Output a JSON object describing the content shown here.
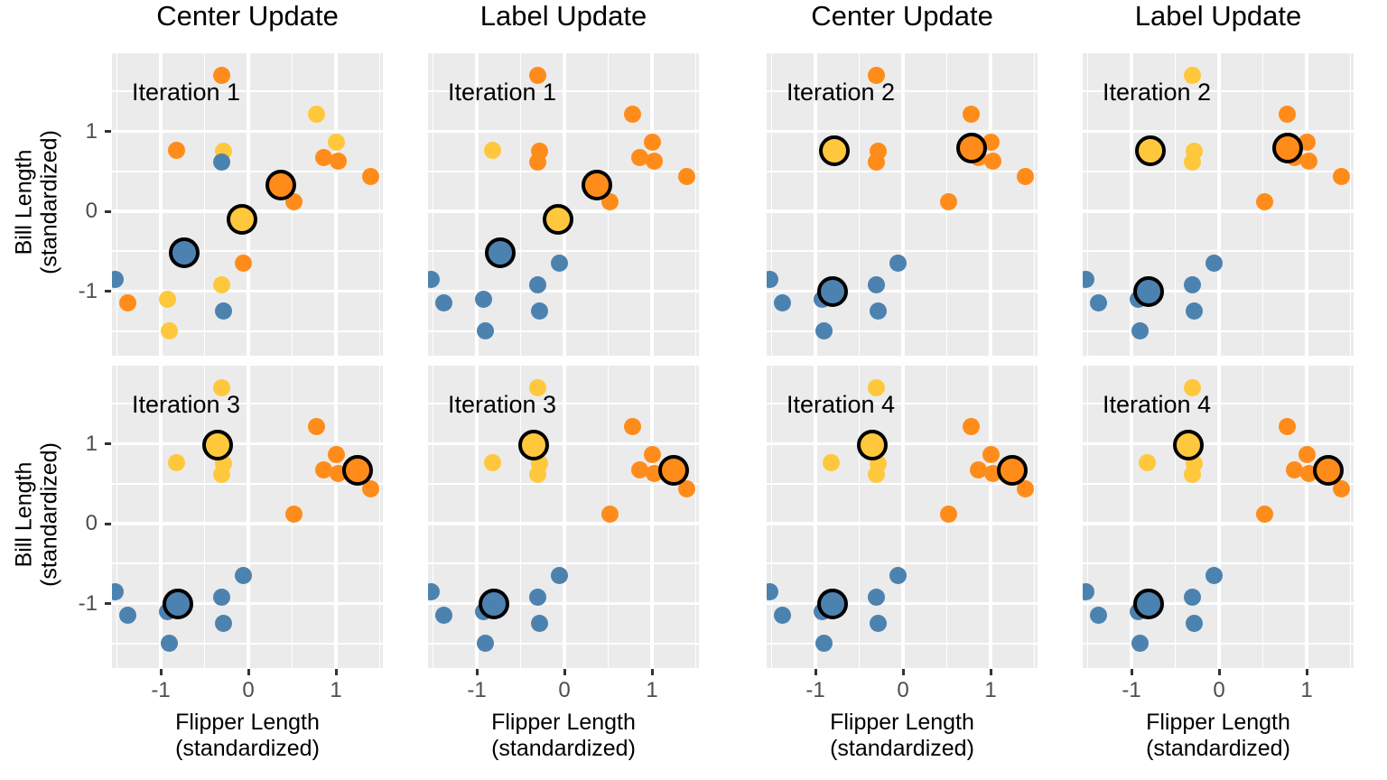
{
  "figure": {
    "type": "small-multiples-scatter",
    "panel_rows": 2,
    "panel_cols": 4,
    "background": "#ffffff",
    "panel_fill": "#ebebeb",
    "gridline_color": "#ffffff"
  },
  "column_titles": [
    "Center Update",
    "Label Update",
    "Center Update",
    "Label Update"
  ],
  "axis": {
    "y_title_line1": "Bill Length",
    "y_title_line2": "(standardized)",
    "x_title_line1": "Flipper Length",
    "x_title_line2": "(standardized)",
    "x_ticks": [
      "-1",
      "0",
      "1"
    ],
    "x_tick_values": [
      -1,
      0,
      1
    ],
    "y_ticks": [
      "1",
      "0",
      "-1"
    ],
    "y_tick_values": [
      1,
      0,
      -1
    ],
    "xlim": [
      -1.72,
      1.62
    ],
    "ylim": [
      -1.72,
      1.78
    ]
  },
  "colors": {
    "blue": "#4C82B0",
    "orange": "#FF8C1A",
    "yellow": "#FFC83C",
    "center_stroke": "#000000",
    "tick_label": "#4d4d4d",
    "tick_mark": "#333333"
  },
  "legend": {
    "cluster_names": [
      "blue",
      "orange",
      "yellow"
    ]
  },
  "chart_data": {
    "type": "scatter",
    "title": "",
    "xlabel": "Flipper Length (standardized)",
    "ylabel": "Bill Length (standardized)",
    "xlim": [
      -1.72,
      1.62
    ],
    "ylim": [
      -1.72,
      1.78
    ],
    "grid": true,
    "legend_position": "none",
    "panels": [
      {
        "row": 0,
        "col": 0,
        "column_title": "Center Update",
        "tag": "Iteration 1",
        "points": [
          {
            "x": -0.3,
            "y": 1.7,
            "c": "orange"
          },
          {
            "x": 0.78,
            "y": 1.22,
            "c": "yellow"
          },
          {
            "x": -0.82,
            "y": 0.76,
            "c": "orange"
          },
          {
            "x": -0.28,
            "y": 0.75,
            "c": "yellow"
          },
          {
            "x": -0.3,
            "y": 0.62,
            "c": "blue"
          },
          {
            "x": 1.0,
            "y": 0.86,
            "c": "yellow"
          },
          {
            "x": 0.86,
            "y": 0.67,
            "c": "orange"
          },
          {
            "x": 1.03,
            "y": 0.63,
            "c": "orange"
          },
          {
            "x": 1.4,
            "y": 0.43,
            "c": "orange"
          },
          {
            "x": 0.52,
            "y": 0.12,
            "c": "orange"
          },
          {
            "x": -0.06,
            "y": -0.65,
            "c": "orange"
          },
          {
            "x": -1.52,
            "y": -0.85,
            "c": "blue"
          },
          {
            "x": -0.3,
            "y": -0.92,
            "c": "yellow"
          },
          {
            "x": -1.38,
            "y": -1.15,
            "c": "orange"
          },
          {
            "x": -0.92,
            "y": -1.1,
            "c": "yellow"
          },
          {
            "x": -0.28,
            "y": -1.25,
            "c": "blue"
          },
          {
            "x": -0.9,
            "y": -1.5,
            "c": "yellow"
          }
        ],
        "centers": [
          {
            "x": -0.73,
            "y": -0.52,
            "c": "blue"
          },
          {
            "x": -0.07,
            "y": -0.1,
            "c": "yellow"
          },
          {
            "x": 0.37,
            "y": 0.33,
            "c": "orange"
          }
        ]
      },
      {
        "row": 0,
        "col": 1,
        "column_title": "Label Update",
        "tag": "Iteration 1",
        "points": [
          {
            "x": -0.3,
            "y": 1.7,
            "c": "orange"
          },
          {
            "x": 0.78,
            "y": 1.22,
            "c": "orange"
          },
          {
            "x": -0.82,
            "y": 0.76,
            "c": "yellow"
          },
          {
            "x": -0.28,
            "y": 0.75,
            "c": "orange"
          },
          {
            "x": -0.3,
            "y": 0.62,
            "c": "orange"
          },
          {
            "x": 1.0,
            "y": 0.86,
            "c": "orange"
          },
          {
            "x": 0.86,
            "y": 0.67,
            "c": "orange"
          },
          {
            "x": 1.03,
            "y": 0.63,
            "c": "orange"
          },
          {
            "x": 1.4,
            "y": 0.43,
            "c": "orange"
          },
          {
            "x": 0.52,
            "y": 0.12,
            "c": "orange"
          },
          {
            "x": -0.06,
            "y": -0.65,
            "c": "blue"
          },
          {
            "x": -1.52,
            "y": -0.85,
            "c": "blue"
          },
          {
            "x": -0.3,
            "y": -0.92,
            "c": "blue"
          },
          {
            "x": -1.38,
            "y": -1.15,
            "c": "blue"
          },
          {
            "x": -0.92,
            "y": -1.1,
            "c": "blue"
          },
          {
            "x": -0.28,
            "y": -1.25,
            "c": "blue"
          },
          {
            "x": -0.9,
            "y": -1.5,
            "c": "blue"
          }
        ],
        "centers": [
          {
            "x": -0.73,
            "y": -0.52,
            "c": "blue"
          },
          {
            "x": -0.07,
            "y": -0.1,
            "c": "yellow"
          },
          {
            "x": 0.37,
            "y": 0.33,
            "c": "orange"
          }
        ]
      },
      {
        "row": 0,
        "col": 2,
        "column_title": "Center Update",
        "tag": "Iteration 2",
        "points": [
          {
            "x": -0.3,
            "y": 1.7,
            "c": "orange"
          },
          {
            "x": 0.78,
            "y": 1.22,
            "c": "orange"
          },
          {
            "x": -0.82,
            "y": 0.76,
            "c": "orange"
          },
          {
            "x": -0.28,
            "y": 0.75,
            "c": "orange"
          },
          {
            "x": -0.3,
            "y": 0.62,
            "c": "orange"
          },
          {
            "x": 1.0,
            "y": 0.86,
            "c": "orange"
          },
          {
            "x": 0.86,
            "y": 0.67,
            "c": "orange"
          },
          {
            "x": 1.03,
            "y": 0.63,
            "c": "orange"
          },
          {
            "x": 1.4,
            "y": 0.43,
            "c": "orange"
          },
          {
            "x": 0.52,
            "y": 0.12,
            "c": "orange"
          },
          {
            "x": -0.06,
            "y": -0.65,
            "c": "blue"
          },
          {
            "x": -1.52,
            "y": -0.85,
            "c": "blue"
          },
          {
            "x": -0.3,
            "y": -0.92,
            "c": "blue"
          },
          {
            "x": -1.38,
            "y": -1.15,
            "c": "blue"
          },
          {
            "x": -0.92,
            "y": -1.1,
            "c": "blue"
          },
          {
            "x": -0.28,
            "y": -1.25,
            "c": "blue"
          },
          {
            "x": -0.9,
            "y": -1.5,
            "c": "blue"
          }
        ],
        "centers": [
          {
            "x": -0.8,
            "y": -1.0,
            "c": "blue"
          },
          {
            "x": -0.78,
            "y": 0.76,
            "c": "yellow"
          },
          {
            "x": 0.78,
            "y": 0.79,
            "c": "orange"
          }
        ]
      },
      {
        "row": 0,
        "col": 3,
        "column_title": "Label Update",
        "tag": "Iteration 2",
        "points": [
          {
            "x": -0.3,
            "y": 1.7,
            "c": "yellow"
          },
          {
            "x": 0.78,
            "y": 1.22,
            "c": "orange"
          },
          {
            "x": -0.82,
            "y": 0.76,
            "c": "yellow"
          },
          {
            "x": -0.28,
            "y": 0.75,
            "c": "yellow"
          },
          {
            "x": -0.3,
            "y": 0.62,
            "c": "yellow"
          },
          {
            "x": 1.0,
            "y": 0.86,
            "c": "orange"
          },
          {
            "x": 0.86,
            "y": 0.67,
            "c": "orange"
          },
          {
            "x": 1.03,
            "y": 0.63,
            "c": "orange"
          },
          {
            "x": 1.4,
            "y": 0.43,
            "c": "orange"
          },
          {
            "x": 0.52,
            "y": 0.12,
            "c": "orange"
          },
          {
            "x": -0.06,
            "y": -0.65,
            "c": "blue"
          },
          {
            "x": -1.52,
            "y": -0.85,
            "c": "blue"
          },
          {
            "x": -0.3,
            "y": -0.92,
            "c": "blue"
          },
          {
            "x": -1.38,
            "y": -1.15,
            "c": "blue"
          },
          {
            "x": -0.92,
            "y": -1.1,
            "c": "blue"
          },
          {
            "x": -0.28,
            "y": -1.25,
            "c": "blue"
          },
          {
            "x": -0.9,
            "y": -1.5,
            "c": "blue"
          }
        ],
        "centers": [
          {
            "x": -0.8,
            "y": -1.0,
            "c": "blue"
          },
          {
            "x": -0.78,
            "y": 0.76,
            "c": "yellow"
          },
          {
            "x": 0.78,
            "y": 0.79,
            "c": "orange"
          }
        ]
      },
      {
        "row": 1,
        "col": 0,
        "column_title": "Center Update",
        "tag": "Iteration 3",
        "points": [
          {
            "x": -0.3,
            "y": 1.7,
            "c": "yellow"
          },
          {
            "x": 0.78,
            "y": 1.22,
            "c": "orange"
          },
          {
            "x": -0.82,
            "y": 0.76,
            "c": "yellow"
          },
          {
            "x": -0.28,
            "y": 0.75,
            "c": "yellow"
          },
          {
            "x": -0.3,
            "y": 0.62,
            "c": "yellow"
          },
          {
            "x": 1.0,
            "y": 0.86,
            "c": "orange"
          },
          {
            "x": 0.86,
            "y": 0.67,
            "c": "orange"
          },
          {
            "x": 1.03,
            "y": 0.63,
            "c": "orange"
          },
          {
            "x": 1.4,
            "y": 0.43,
            "c": "orange"
          },
          {
            "x": 0.52,
            "y": 0.12,
            "c": "orange"
          },
          {
            "x": -0.06,
            "y": -0.65,
            "c": "blue"
          },
          {
            "x": -1.52,
            "y": -0.85,
            "c": "blue"
          },
          {
            "x": -0.3,
            "y": -0.92,
            "c": "blue"
          },
          {
            "x": -1.38,
            "y": -1.15,
            "c": "blue"
          },
          {
            "x": -0.92,
            "y": -1.1,
            "c": "blue"
          },
          {
            "x": -0.28,
            "y": -1.25,
            "c": "blue"
          },
          {
            "x": -0.9,
            "y": -1.5,
            "c": "blue"
          }
        ],
        "centers": [
          {
            "x": -0.8,
            "y": -1.0,
            "c": "blue"
          },
          {
            "x": -0.35,
            "y": 0.98,
            "c": "yellow"
          },
          {
            "x": 1.25,
            "y": 0.67,
            "c": "orange"
          }
        ]
      },
      {
        "row": 1,
        "col": 1,
        "column_title": "Label Update",
        "tag": "Iteration 3",
        "points": [
          {
            "x": -0.3,
            "y": 1.7,
            "c": "yellow"
          },
          {
            "x": 0.78,
            "y": 1.22,
            "c": "orange"
          },
          {
            "x": -0.82,
            "y": 0.76,
            "c": "yellow"
          },
          {
            "x": -0.28,
            "y": 0.75,
            "c": "yellow"
          },
          {
            "x": -0.3,
            "y": 0.62,
            "c": "yellow"
          },
          {
            "x": 1.0,
            "y": 0.86,
            "c": "orange"
          },
          {
            "x": 0.86,
            "y": 0.67,
            "c": "orange"
          },
          {
            "x": 1.03,
            "y": 0.63,
            "c": "orange"
          },
          {
            "x": 1.4,
            "y": 0.43,
            "c": "orange"
          },
          {
            "x": 0.52,
            "y": 0.12,
            "c": "orange"
          },
          {
            "x": -0.06,
            "y": -0.65,
            "c": "blue"
          },
          {
            "x": -1.52,
            "y": -0.85,
            "c": "blue"
          },
          {
            "x": -0.3,
            "y": -0.92,
            "c": "blue"
          },
          {
            "x": -1.38,
            "y": -1.15,
            "c": "blue"
          },
          {
            "x": -0.92,
            "y": -1.1,
            "c": "blue"
          },
          {
            "x": -0.28,
            "y": -1.25,
            "c": "blue"
          },
          {
            "x": -0.9,
            "y": -1.5,
            "c": "blue"
          }
        ],
        "centers": [
          {
            "x": -0.8,
            "y": -1.0,
            "c": "blue"
          },
          {
            "x": -0.35,
            "y": 0.98,
            "c": "yellow"
          },
          {
            "x": 1.25,
            "y": 0.67,
            "c": "orange"
          }
        ]
      },
      {
        "row": 1,
        "col": 2,
        "column_title": "Center Update",
        "tag": "Iteration 4",
        "points": [
          {
            "x": -0.3,
            "y": 1.7,
            "c": "yellow"
          },
          {
            "x": 0.78,
            "y": 1.22,
            "c": "orange"
          },
          {
            "x": -0.82,
            "y": 0.76,
            "c": "yellow"
          },
          {
            "x": -0.28,
            "y": 0.75,
            "c": "yellow"
          },
          {
            "x": -0.3,
            "y": 0.62,
            "c": "yellow"
          },
          {
            "x": 1.0,
            "y": 0.86,
            "c": "orange"
          },
          {
            "x": 0.86,
            "y": 0.67,
            "c": "orange"
          },
          {
            "x": 1.03,
            "y": 0.63,
            "c": "orange"
          },
          {
            "x": 1.4,
            "y": 0.43,
            "c": "orange"
          },
          {
            "x": 0.52,
            "y": 0.12,
            "c": "orange"
          },
          {
            "x": -0.06,
            "y": -0.65,
            "c": "blue"
          },
          {
            "x": -1.52,
            "y": -0.85,
            "c": "blue"
          },
          {
            "x": -0.3,
            "y": -0.92,
            "c": "blue"
          },
          {
            "x": -1.38,
            "y": -1.15,
            "c": "blue"
          },
          {
            "x": -0.92,
            "y": -1.1,
            "c": "blue"
          },
          {
            "x": -0.28,
            "y": -1.25,
            "c": "blue"
          },
          {
            "x": -0.9,
            "y": -1.5,
            "c": "blue"
          }
        ],
        "centers": [
          {
            "x": -0.8,
            "y": -1.0,
            "c": "blue"
          },
          {
            "x": -0.35,
            "y": 0.98,
            "c": "yellow"
          },
          {
            "x": 1.25,
            "y": 0.67,
            "c": "orange"
          }
        ]
      },
      {
        "row": 1,
        "col": 3,
        "column_title": "Label Update",
        "tag": "Iteration 4",
        "points": [
          {
            "x": -0.3,
            "y": 1.7,
            "c": "yellow"
          },
          {
            "x": 0.78,
            "y": 1.22,
            "c": "orange"
          },
          {
            "x": -0.82,
            "y": 0.76,
            "c": "yellow"
          },
          {
            "x": -0.28,
            "y": 0.75,
            "c": "yellow"
          },
          {
            "x": -0.3,
            "y": 0.62,
            "c": "yellow"
          },
          {
            "x": 1.0,
            "y": 0.86,
            "c": "orange"
          },
          {
            "x": 0.86,
            "y": 0.67,
            "c": "orange"
          },
          {
            "x": 1.03,
            "y": 0.63,
            "c": "orange"
          },
          {
            "x": 1.4,
            "y": 0.43,
            "c": "orange"
          },
          {
            "x": 0.52,
            "y": 0.12,
            "c": "orange"
          },
          {
            "x": -0.06,
            "y": -0.65,
            "c": "blue"
          },
          {
            "x": -1.52,
            "y": -0.85,
            "c": "blue"
          },
          {
            "x": -0.3,
            "y": -0.92,
            "c": "blue"
          },
          {
            "x": -1.38,
            "y": -1.15,
            "c": "blue"
          },
          {
            "x": -0.92,
            "y": -1.1,
            "c": "blue"
          },
          {
            "x": -0.28,
            "y": -1.25,
            "c": "blue"
          },
          {
            "x": -0.9,
            "y": -1.5,
            "c": "blue"
          }
        ],
        "centers": [
          {
            "x": -0.8,
            "y": -1.0,
            "c": "blue"
          },
          {
            "x": -0.35,
            "y": 0.98,
            "c": "yellow"
          },
          {
            "x": 1.25,
            "y": 0.67,
            "c": "orange"
          }
        ]
      }
    ]
  }
}
